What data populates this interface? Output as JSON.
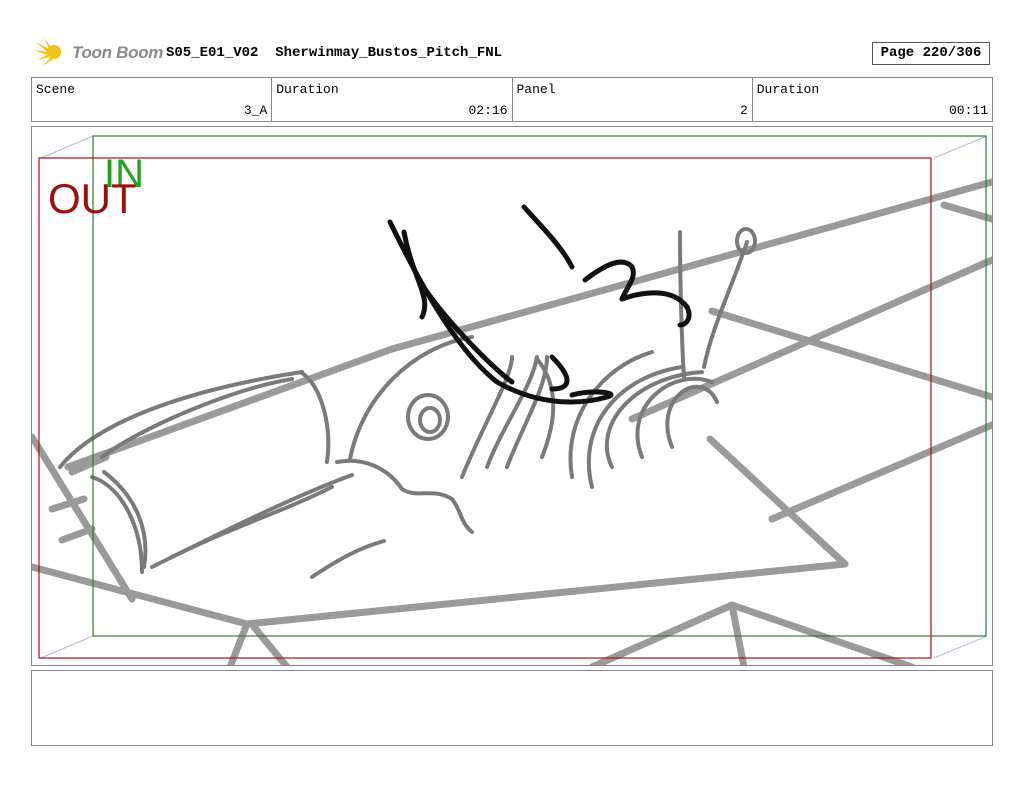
{
  "logo": {
    "text": "Toon Boom"
  },
  "header": {
    "title": "S05_E01_V02  Sherwinmay_Bustos_Pitch_FNL",
    "page": "Page 220/306"
  },
  "info": {
    "scene_label": "Scene",
    "scene_value": "3_A",
    "scene_duration_label": "Duration",
    "scene_duration_value": "02:16",
    "panel_label": "Panel",
    "panel_value": "2",
    "panel_duration_label": "Duration",
    "panel_duration_value": "00:11"
  },
  "frame_labels": {
    "in": "IN",
    "out": "OUT"
  },
  "colors": {
    "in_frame": "#2e7d32",
    "out_frame": "#a31515",
    "in_text": "#22a022",
    "out_text": "#9b0f0f",
    "sketch_gray": "#8c8c8c",
    "sketch_dark": "#111111"
  }
}
